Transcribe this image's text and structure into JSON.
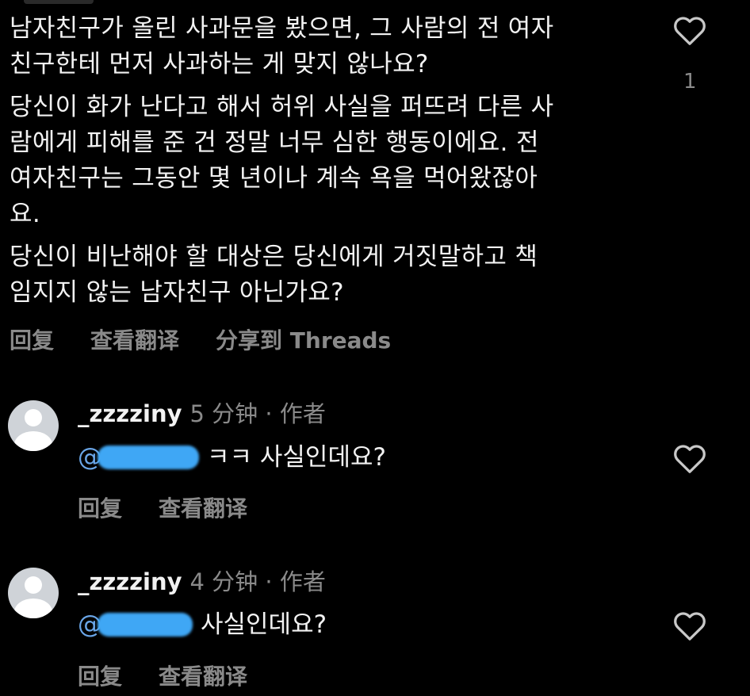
{
  "main_comment": {
    "paragraphs": [
      "남자친구가 올린 사과문을 봤으면, 그 사람의 전 여자\n친구한테 먼저 사과하는 게 맞지 않나요?",
      "당신이 화가 난다고 해서 허위 사실을 퍼뜨려 다른 사\n람에게 피해를 준 건 정말 너무 심한 행동이에요. 전\n여자친구는 그동안 몇 년이나 계속 욕을 먹어왔잖아\n요.",
      "당신이 비난해야 할 대상은 당신에게 거짓말하고 책\n임지지 않는 남자친구 아닌가요?"
    ],
    "like_count": "1",
    "actions": {
      "reply": "回复",
      "translate": "查看翻译",
      "share": "分享到 Threads"
    }
  },
  "replies": [
    {
      "username": "_zzzziny",
      "time": "5 分钟 · 作者",
      "mention_prefix": "@",
      "text": "ㅋㅋ 사실인데요?",
      "actions": {
        "reply": "回复",
        "translate": "查看翻译"
      }
    },
    {
      "username": "_zzzziny",
      "time": "4 分钟 · 作者",
      "mention_prefix": "@",
      "text": "사실인데요?",
      "actions": {
        "reply": "回复",
        "translate": "查看翻译"
      }
    }
  ],
  "icons": {
    "like": "heart-outline-icon",
    "avatar": "default-avatar-icon"
  },
  "colors": {
    "background": "#000000",
    "text": "#f2f2f2",
    "muted": "#8a8a8a",
    "mention": "#6aa6e8",
    "redaction": "#3fa7f5"
  }
}
